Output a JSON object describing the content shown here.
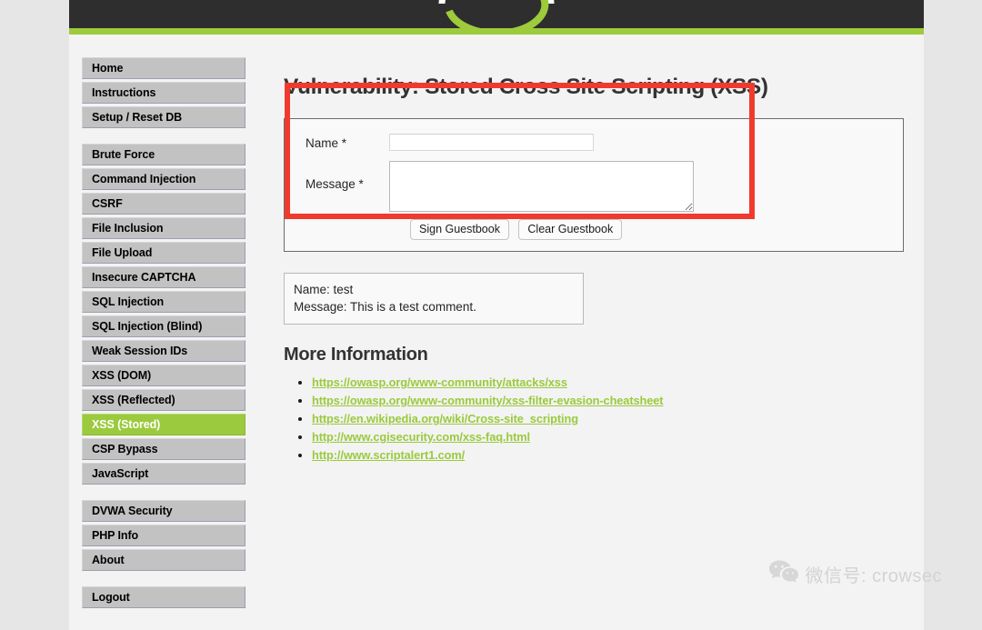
{
  "site": {
    "logo_alt": "dvwa-logo",
    "accent_green": "#9bca3e",
    "header_dark": "#2e2e2e",
    "highlight_red": "#f03a2e"
  },
  "sidebar": {
    "groups": [
      {
        "items": [
          {
            "label": "Home",
            "active": false
          },
          {
            "label": "Instructions",
            "active": false
          },
          {
            "label": "Setup / Reset DB",
            "active": false
          }
        ]
      },
      {
        "items": [
          {
            "label": "Brute Force",
            "active": false
          },
          {
            "label": "Command Injection",
            "active": false
          },
          {
            "label": "CSRF",
            "active": false
          },
          {
            "label": "File Inclusion",
            "active": false
          },
          {
            "label": "File Upload",
            "active": false
          },
          {
            "label": "Insecure CAPTCHA",
            "active": false
          },
          {
            "label": "SQL Injection",
            "active": false
          },
          {
            "label": "SQL Injection (Blind)",
            "active": false
          },
          {
            "label": "Weak Session IDs",
            "active": false
          },
          {
            "label": "XSS (DOM)",
            "active": false
          },
          {
            "label": "XSS (Reflected)",
            "active": false
          },
          {
            "label": "XSS (Stored)",
            "active": true
          },
          {
            "label": "CSP Bypass",
            "active": false
          },
          {
            "label": "JavaScript",
            "active": false
          }
        ]
      },
      {
        "items": [
          {
            "label": "DVWA Security",
            "active": false
          },
          {
            "label": "PHP Info",
            "active": false
          },
          {
            "label": "About",
            "active": false
          }
        ]
      },
      {
        "items": [
          {
            "label": "Logout",
            "active": false
          }
        ]
      }
    ]
  },
  "main": {
    "page_title": "Vulnerability: Stored Cross Site Scripting (XSS)",
    "form": {
      "name_label": "Name *",
      "name_value": "",
      "name_placeholder": "",
      "message_label": "Message *",
      "message_value": "",
      "message_placeholder": "",
      "sign_button": "Sign Guestbook",
      "clear_button": "Clear Guestbook"
    },
    "guestbook_entries": [
      {
        "name_line": "Name: test",
        "message_line": "Message: This is a test comment."
      }
    ],
    "more_information": {
      "heading": "More Information",
      "links": [
        "https://owasp.org/www-community/attacks/xss",
        "https://owasp.org/www-community/xss-filter-evasion-cheatsheet",
        "https://en.wikipedia.org/wiki/Cross-site_scripting",
        "http://www.cgisecurity.com/xss-faq.html",
        "http://www.scriptalert1.com/"
      ]
    }
  },
  "watermark": {
    "text": "微信号: crowsec",
    "icon": "wechat-icon"
  }
}
